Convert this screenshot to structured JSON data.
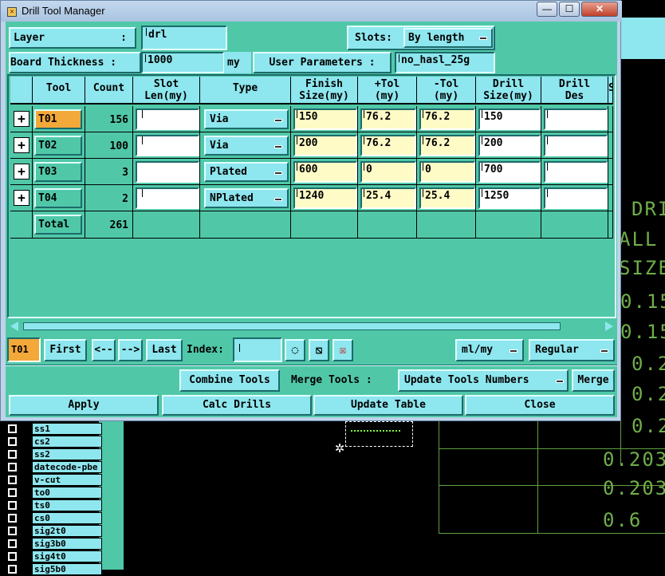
{
  "window": {
    "title": "Drill Tool Manager"
  },
  "top": {
    "layer_label": "Layer",
    "layer_colon": ":",
    "layer_value": "drl",
    "slots_label": "Slots:",
    "slots_value": "By length",
    "thickness_label": "Board Thickness :",
    "thickness_value": "1000",
    "thickness_unit": "my",
    "user_params_label": "User Parameters :",
    "user_params_value": "no_hasl_25g"
  },
  "table": {
    "headers": [
      {
        "l1": "Tool",
        "l2": ""
      },
      {
        "l1": "Count",
        "l2": ""
      },
      {
        "l1": "Slot",
        "l2": "Len(my)"
      },
      {
        "l1": "Type",
        "l2": ""
      },
      {
        "l1": "Finish",
        "l2": "Size(my)"
      },
      {
        "l1": "+Tol",
        "l2": "(my)"
      },
      {
        "l1": "-Tol",
        "l2": "(my)"
      },
      {
        "l1": "Drill",
        "l2": "Size(my)"
      },
      {
        "l1": "Drill",
        "l2": "Des"
      },
      {
        "l1": "S",
        "l2": ""
      }
    ],
    "rows": [
      {
        "expand": "+",
        "tool": "T01",
        "count": "156",
        "slot": "",
        "type": "Via",
        "finish": "150",
        "ptol": "76.2",
        "mtol": "76.2",
        "drill": "150",
        "des": ""
      },
      {
        "expand": "+",
        "tool": "T02",
        "count": "100",
        "slot": "",
        "type": "Via",
        "finish": "200",
        "ptol": "76.2",
        "mtol": "76.2",
        "drill": "200",
        "des": ""
      },
      {
        "expand": "+",
        "tool": "T03",
        "count": "3",
        "slot": "",
        "type": "Plated",
        "finish": "600",
        "ptol": "0",
        "mtol": "0",
        "drill": "700",
        "des": ""
      },
      {
        "expand": "+",
        "tool": "T04",
        "count": "2",
        "slot": "",
        "type": "NPlated",
        "finish": "1240",
        "ptol": "25.4",
        "mtol": "25.4",
        "drill": "1250",
        "des": ""
      }
    ],
    "total_label": "Total",
    "total_count": "261"
  },
  "nav": {
    "current": "T01",
    "first": "First",
    "prev": "<--",
    "next": "-->",
    "last": "Last",
    "index_label": "Index:",
    "index_value": "",
    "units": "ml/my",
    "mode": "Regular"
  },
  "actions": {
    "combine": "Combine Tools",
    "merge_label": "Merge Tools :",
    "merge_option": "Update Tools Numbers",
    "merge": "Merge",
    "apply": "Apply",
    "calc": "Calc Drills",
    "update": "Update Table",
    "close": "Close"
  },
  "background": {
    "layers": [
      "ss1",
      "cs2",
      "ss2",
      "datecode-pbe",
      "v-cut",
      "to0",
      "ts0",
      "cs0",
      "sig2t0",
      "sig3b0",
      "sig4t0",
      "sig5b0"
    ],
    "col_texts": [
      "DRI",
      "ALL",
      "SIZE",
      "0.15",
      "0.15",
      "0.2",
      "0.2",
      "0.2",
      "0.203",
      "0.203",
      "0.6"
    ]
  },
  "colors": {
    "panel": "#50c8a8",
    "field": "#8ee6ee",
    "selected": "#f3a83a",
    "yellow_field": "#fefbc6"
  }
}
